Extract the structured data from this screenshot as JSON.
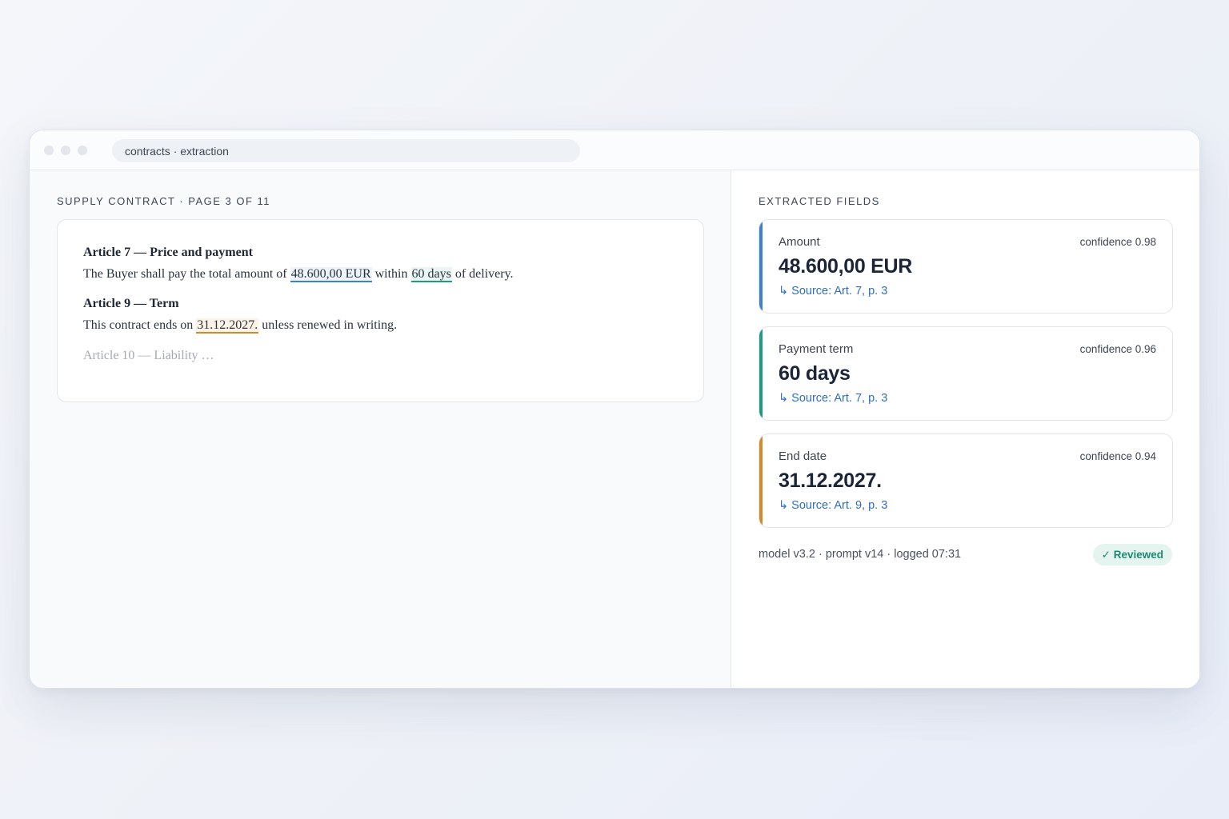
{
  "window": {
    "address": "contracts · extraction"
  },
  "document": {
    "label": "SUPPLY CONTRACT · PAGE 3 OF 11",
    "articles": [
      {
        "heading": "Article 7 — Price and payment",
        "text_before": "The Buyer shall pay the total amount of ",
        "amount": "48.600,00 EUR",
        "text_mid": " within ",
        "term": "60 days",
        "text_after": " of delivery."
      },
      {
        "heading": "Article 9 — Term",
        "text_before": "This contract ends on ",
        "date": "31.12.2027.",
        "text_after": " unless renewed in writing."
      }
    ],
    "faded": "Article 10 — Liability …"
  },
  "extracted": {
    "label": "EXTRACTED FIELDS",
    "fields": [
      {
        "label": "Amount",
        "confidence": "confidence 0.98",
        "value": "48.600,00 EUR",
        "source": "↳ Source: Art. 7, p. 3",
        "color": "#3f7fd0"
      },
      {
        "label": "Payment term",
        "confidence": "confidence 0.96",
        "value": "60 days",
        "source": "↳ Source: Art. 7, p. 3",
        "color": "#1f9a84"
      },
      {
        "label": "End date",
        "confidence": "confidence 0.94",
        "value": "31.12.2027.",
        "source": "↳ Source: Art. 9, p. 3",
        "color": "#d58a2a"
      }
    ],
    "meta": "model v3.2 · prompt v14 · logged 07:31",
    "badge": "✓ Reviewed"
  }
}
